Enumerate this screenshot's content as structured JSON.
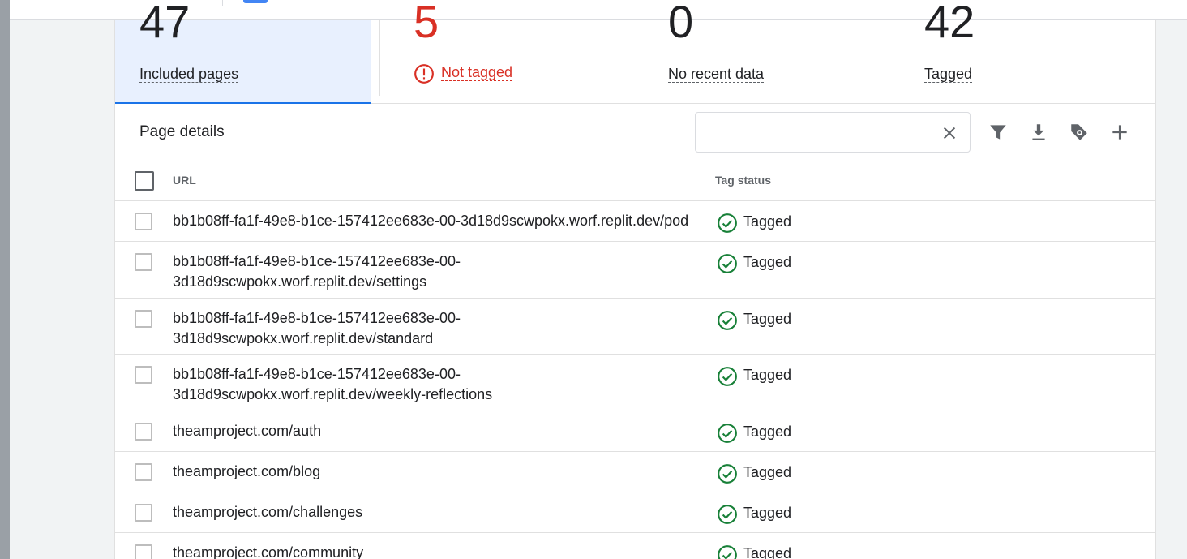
{
  "summary": {
    "included": {
      "count": "47",
      "label": "Included pages"
    },
    "not_tagged": {
      "count": "5",
      "label": "Not tagged"
    },
    "no_recent": {
      "count": "0",
      "label": "No recent data"
    },
    "tagged": {
      "count": "42",
      "label": "Tagged"
    }
  },
  "toolbar": {
    "title": "Page details",
    "search_value": "",
    "icons": [
      "close-icon",
      "filter-icon",
      "download-icon",
      "tag-settings-icon",
      "add-icon"
    ]
  },
  "table": {
    "columns": [
      "URL",
      "Tag status"
    ],
    "rows": [
      {
        "url": "bb1b08ff-fa1f-49e8-b1ce-157412ee683e-00-3d18d9scwpokx.worf.replit.dev/pod",
        "status": "Tagged"
      },
      {
        "url_line1": "bb1b08ff-fa1f-49e8-b1ce-157412ee683e-00-",
        "url_line2": "3d18d9scwpokx.worf.replit.dev/settings",
        "status": "Tagged"
      },
      {
        "url_line1": "bb1b08ff-fa1f-49e8-b1ce-157412ee683e-00-",
        "url_line2": "3d18d9scwpokx.worf.replit.dev/standard",
        "status": "Tagged"
      },
      {
        "url_line1": "bb1b08ff-fa1f-49e8-b1ce-157412ee683e-00-",
        "url_line2": "3d18d9scwpokx.worf.replit.dev/weekly-reflections",
        "status": "Tagged"
      },
      {
        "url": "theamproject.com/auth",
        "status": "Tagged"
      },
      {
        "url": "theamproject.com/blog",
        "status": "Tagged"
      },
      {
        "url": "theamproject.com/challenges",
        "status": "Tagged"
      },
      {
        "url": "theamproject.com/community",
        "status": "Tagged"
      }
    ]
  },
  "colors": {
    "accent": "#1a73e8",
    "error": "#d93025",
    "success": "#188038",
    "active_bg": "#e8f0fe"
  }
}
